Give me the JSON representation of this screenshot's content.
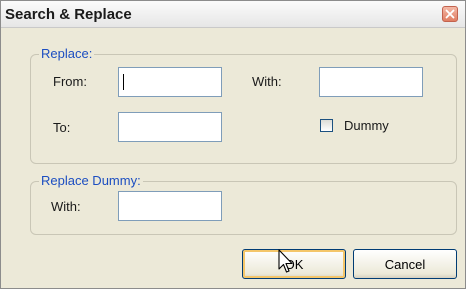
{
  "window": {
    "title": "Search & Replace"
  },
  "replace_group": {
    "legend": "Replace:",
    "from_label": "From:",
    "from_value": "",
    "to_label": "To:",
    "to_value": "",
    "with_label": "With:",
    "with_value": "",
    "dummy_label": "Dummy",
    "dummy_checked": false
  },
  "replace_dummy_group": {
    "legend": "Replace Dummy:",
    "with_label": "With:",
    "with_value": ""
  },
  "buttons": {
    "ok_label": "OK",
    "cancel_label": "Cancel"
  },
  "colors": {
    "accent": "#1c4ec1",
    "close_button": "#e07d62",
    "default_button_glow": "#f4c66a"
  },
  "icons": [
    "close-icon",
    "pointer-cursor-icon"
  ]
}
